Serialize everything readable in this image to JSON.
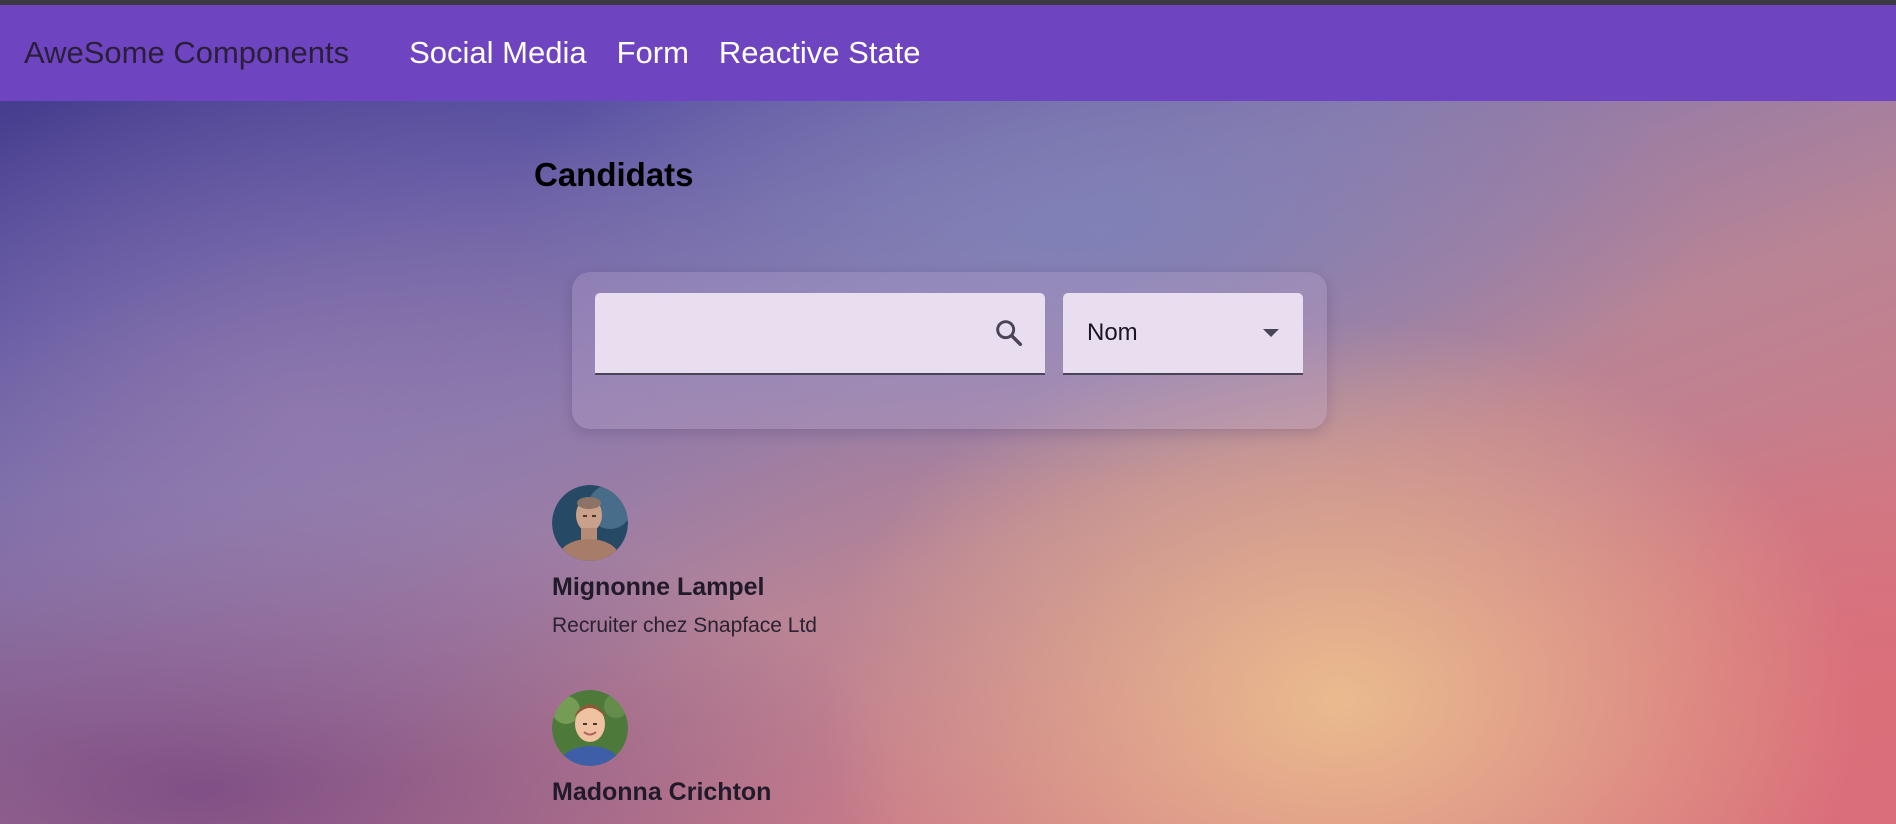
{
  "toolbar": {
    "brand": "AweSome Components",
    "nav": [
      {
        "label": "Social Media"
      },
      {
        "label": "Form"
      },
      {
        "label": "Reactive State"
      }
    ],
    "background_color": "#6f44c0"
  },
  "main": {
    "title": "Candidats",
    "filter": {
      "search_value": "",
      "search_icon": "search-icon",
      "select_value": "Nom",
      "select_icon": "caret-down-icon"
    },
    "candidates": [
      {
        "name": "Mignonne Lampel",
        "role": "Recruiter chez Snapface Ltd",
        "avatar": "avatar-man"
      },
      {
        "name": "Madonna Crichton",
        "role": "",
        "avatar": "avatar-boy"
      }
    ]
  }
}
